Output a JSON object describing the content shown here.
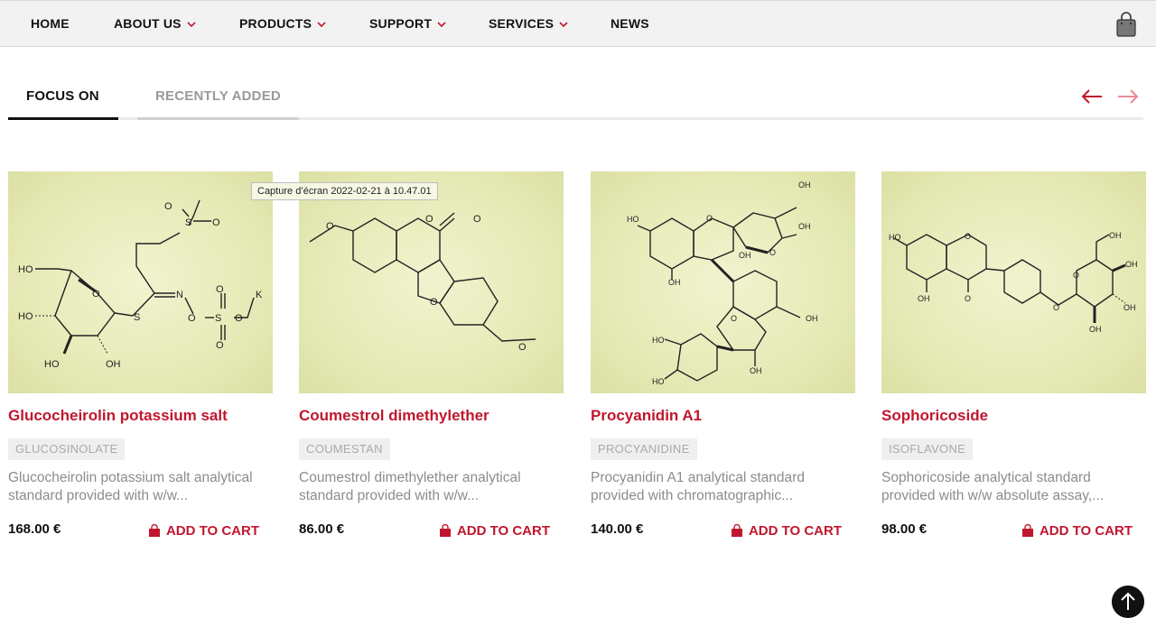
{
  "nav": {
    "items": [
      {
        "label": "HOME",
        "has_dropdown": false
      },
      {
        "label": "ABOUT US",
        "has_dropdown": true
      },
      {
        "label": "PRODUCTS",
        "has_dropdown": true
      },
      {
        "label": "SUPPORT",
        "has_dropdown": true
      },
      {
        "label": "SERVICES",
        "has_dropdown": true
      },
      {
        "label": "NEWS",
        "has_dropdown": false
      }
    ],
    "cart_icon": "shopping-bag-icon",
    "accent_color": "#c0172e"
  },
  "tabs": {
    "active": "FOCUS ON",
    "items": [
      {
        "label": "FOCUS ON"
      },
      {
        "label": "RECENTLY ADDED"
      }
    ]
  },
  "carousel": {
    "prev_icon": "arrow-left-icon",
    "next_icon": "arrow-right-icon"
  },
  "tooltip": {
    "text": "Capture d’écran 2022-02-21 à 10.47.01"
  },
  "products": [
    {
      "title": "Glucocheirolin potassium salt",
      "tag": "GLUCOSINOLATE",
      "description": "Glucocheirolin potassium salt analytical standard provided with w/w...",
      "price": "168.00 €",
      "cart_label": "ADD TO CART"
    },
    {
      "title": "Coumestrol dimethylether",
      "tag": "COUMESTAN",
      "description": "Coumestrol dimethylether analytical standard provided with w/w...",
      "price": "86.00 €",
      "cart_label": "ADD TO CART"
    },
    {
      "title": "Procyanidin A1",
      "tag": "PROCYANIDINE",
      "description": "Procyanidin A1 analytical standard provided with chromatographic...",
      "price": "140.00 €",
      "cart_label": "ADD TO CART"
    },
    {
      "title": "Sophoricoside",
      "tag": "ISOFLAVONE",
      "description": "Sophoricoside analytical standard provided with w/w absolute assay,...",
      "price": "98.00 €",
      "cart_label": "ADD TO CART"
    }
  ],
  "molecule_labels": {
    "p1": [
      "HO",
      "HO",
      "HO",
      "OH",
      "O",
      "S",
      "N",
      "O",
      "S",
      "O",
      "O",
      "O",
      "K",
      "S",
      "O",
      "O"
    ],
    "p2": [
      "O",
      "O",
      "O",
      "O",
      "O"
    ],
    "p3": [
      "HO",
      "OH",
      "OH",
      "OH",
      "O",
      "O",
      "O",
      "OH",
      "HO",
      "HO",
      "OH",
      "OH"
    ],
    "p4": [
      "HO",
      "O",
      "OH",
      "O",
      "O",
      "O",
      "OH",
      "OH",
      "OH",
      "OH"
    ]
  },
  "back_to_top_icon": "arrow-up-icon"
}
